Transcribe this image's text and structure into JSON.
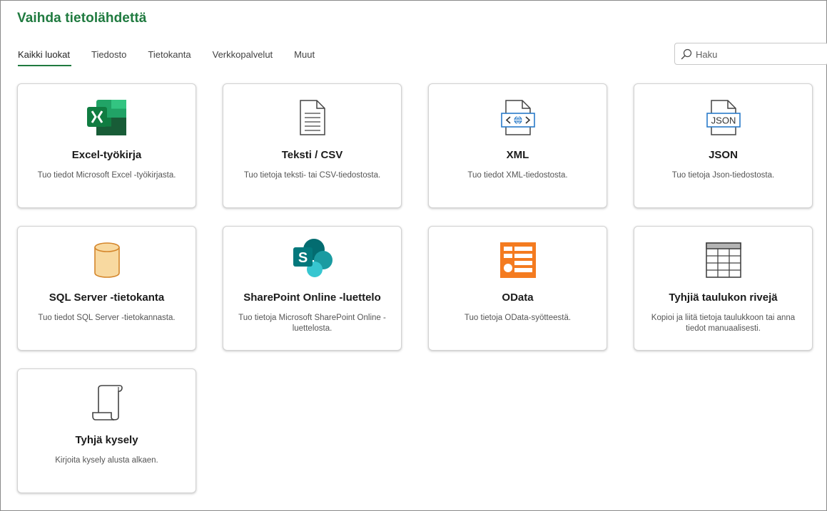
{
  "title": "Vaihda tietolähdettä",
  "tabs": [
    {
      "label": "Kaikki luokat",
      "active": true
    },
    {
      "label": "Tiedosto",
      "active": false
    },
    {
      "label": "Tietokanta",
      "active": false
    },
    {
      "label": "Verkkopalvelut",
      "active": false
    },
    {
      "label": "Muut",
      "active": false
    }
  ],
  "search": {
    "placeholder": "Haku",
    "value": ""
  },
  "colors": {
    "accent": "#1f7a3f",
    "excel": "#107c41",
    "sharepoint": "#036c70",
    "odata": "#f47b20",
    "json_blue": "#2a7bc9"
  },
  "cards": [
    {
      "icon": "excel-icon",
      "title": "Excel-työkirja",
      "description": "Tuo tiedot Microsoft Excel -työkirjasta."
    },
    {
      "icon": "text-file-icon",
      "title": "Teksti / CSV",
      "description": "Tuo tietoja teksti- tai CSV-tiedostosta."
    },
    {
      "icon": "xml-file-icon",
      "title": "XML",
      "description": "Tuo tiedot XML-tiedostosta."
    },
    {
      "icon": "json-file-icon",
      "title": "JSON",
      "description": "Tuo tietoja Json-tiedostosta."
    },
    {
      "icon": "database-icon",
      "title": "SQL Server -tietokanta",
      "description": "Tuo tiedot SQL Server -tietokannasta."
    },
    {
      "icon": "sharepoint-icon",
      "title": "SharePoint Online -luettelo",
      "description": "Tuo tietoja Microsoft SharePoint Online -luettelosta."
    },
    {
      "icon": "odata-icon",
      "title": "OData",
      "description": "Tuo tietoja OData-syötteestä."
    },
    {
      "icon": "table-icon",
      "title": "Tyhjiä taulukon rivejä",
      "description": "Kopioi ja liitä tietoja taulukkoon tai anna tiedot manuaalisesti."
    },
    {
      "icon": "scroll-icon",
      "title": "Tyhjä kysely",
      "description": "Kirjoita kysely alusta alkaen."
    }
  ]
}
